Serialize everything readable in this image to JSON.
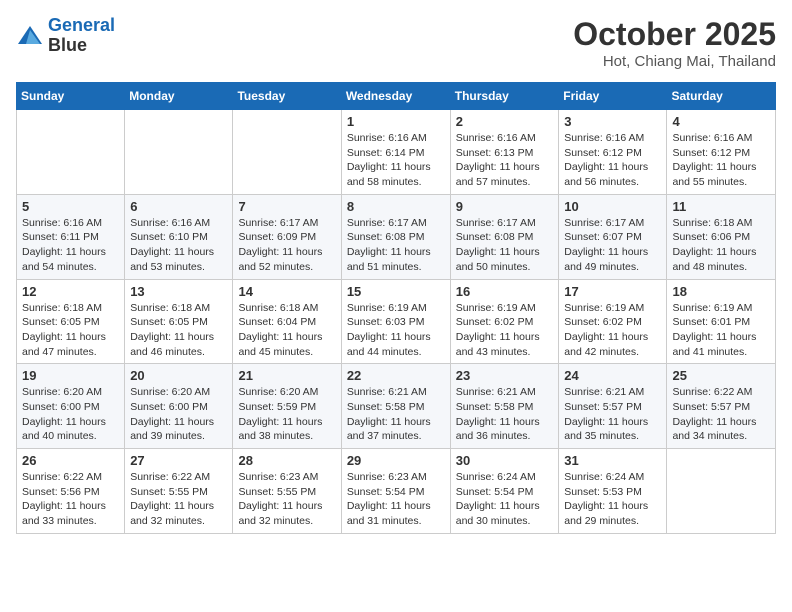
{
  "header": {
    "logo_line1": "General",
    "logo_line2": "Blue",
    "month": "October 2025",
    "location": "Hot, Chiang Mai, Thailand"
  },
  "weekdays": [
    "Sunday",
    "Monday",
    "Tuesday",
    "Wednesday",
    "Thursday",
    "Friday",
    "Saturday"
  ],
  "weeks": [
    [
      {
        "day": "",
        "info": ""
      },
      {
        "day": "",
        "info": ""
      },
      {
        "day": "",
        "info": ""
      },
      {
        "day": "1",
        "info": "Sunrise: 6:16 AM\nSunset: 6:14 PM\nDaylight: 11 hours\nand 58 minutes."
      },
      {
        "day": "2",
        "info": "Sunrise: 6:16 AM\nSunset: 6:13 PM\nDaylight: 11 hours\nand 57 minutes."
      },
      {
        "day": "3",
        "info": "Sunrise: 6:16 AM\nSunset: 6:12 PM\nDaylight: 11 hours\nand 56 minutes."
      },
      {
        "day": "4",
        "info": "Sunrise: 6:16 AM\nSunset: 6:12 PM\nDaylight: 11 hours\nand 55 minutes."
      }
    ],
    [
      {
        "day": "5",
        "info": "Sunrise: 6:16 AM\nSunset: 6:11 PM\nDaylight: 11 hours\nand 54 minutes."
      },
      {
        "day": "6",
        "info": "Sunrise: 6:16 AM\nSunset: 6:10 PM\nDaylight: 11 hours\nand 53 minutes."
      },
      {
        "day": "7",
        "info": "Sunrise: 6:17 AM\nSunset: 6:09 PM\nDaylight: 11 hours\nand 52 minutes."
      },
      {
        "day": "8",
        "info": "Sunrise: 6:17 AM\nSunset: 6:08 PM\nDaylight: 11 hours\nand 51 minutes."
      },
      {
        "day": "9",
        "info": "Sunrise: 6:17 AM\nSunset: 6:08 PM\nDaylight: 11 hours\nand 50 minutes."
      },
      {
        "day": "10",
        "info": "Sunrise: 6:17 AM\nSunset: 6:07 PM\nDaylight: 11 hours\nand 49 minutes."
      },
      {
        "day": "11",
        "info": "Sunrise: 6:18 AM\nSunset: 6:06 PM\nDaylight: 11 hours\nand 48 minutes."
      }
    ],
    [
      {
        "day": "12",
        "info": "Sunrise: 6:18 AM\nSunset: 6:05 PM\nDaylight: 11 hours\nand 47 minutes."
      },
      {
        "day": "13",
        "info": "Sunrise: 6:18 AM\nSunset: 6:05 PM\nDaylight: 11 hours\nand 46 minutes."
      },
      {
        "day": "14",
        "info": "Sunrise: 6:18 AM\nSunset: 6:04 PM\nDaylight: 11 hours\nand 45 minutes."
      },
      {
        "day": "15",
        "info": "Sunrise: 6:19 AM\nSunset: 6:03 PM\nDaylight: 11 hours\nand 44 minutes."
      },
      {
        "day": "16",
        "info": "Sunrise: 6:19 AM\nSunset: 6:02 PM\nDaylight: 11 hours\nand 43 minutes."
      },
      {
        "day": "17",
        "info": "Sunrise: 6:19 AM\nSunset: 6:02 PM\nDaylight: 11 hours\nand 42 minutes."
      },
      {
        "day": "18",
        "info": "Sunrise: 6:19 AM\nSunset: 6:01 PM\nDaylight: 11 hours\nand 41 minutes."
      }
    ],
    [
      {
        "day": "19",
        "info": "Sunrise: 6:20 AM\nSunset: 6:00 PM\nDaylight: 11 hours\nand 40 minutes."
      },
      {
        "day": "20",
        "info": "Sunrise: 6:20 AM\nSunset: 6:00 PM\nDaylight: 11 hours\nand 39 minutes."
      },
      {
        "day": "21",
        "info": "Sunrise: 6:20 AM\nSunset: 5:59 PM\nDaylight: 11 hours\nand 38 minutes."
      },
      {
        "day": "22",
        "info": "Sunrise: 6:21 AM\nSunset: 5:58 PM\nDaylight: 11 hours\nand 37 minutes."
      },
      {
        "day": "23",
        "info": "Sunrise: 6:21 AM\nSunset: 5:58 PM\nDaylight: 11 hours\nand 36 minutes."
      },
      {
        "day": "24",
        "info": "Sunrise: 6:21 AM\nSunset: 5:57 PM\nDaylight: 11 hours\nand 35 minutes."
      },
      {
        "day": "25",
        "info": "Sunrise: 6:22 AM\nSunset: 5:57 PM\nDaylight: 11 hours\nand 34 minutes."
      }
    ],
    [
      {
        "day": "26",
        "info": "Sunrise: 6:22 AM\nSunset: 5:56 PM\nDaylight: 11 hours\nand 33 minutes."
      },
      {
        "day": "27",
        "info": "Sunrise: 6:22 AM\nSunset: 5:55 PM\nDaylight: 11 hours\nand 32 minutes."
      },
      {
        "day": "28",
        "info": "Sunrise: 6:23 AM\nSunset: 5:55 PM\nDaylight: 11 hours\nand 32 minutes."
      },
      {
        "day": "29",
        "info": "Sunrise: 6:23 AM\nSunset: 5:54 PM\nDaylight: 11 hours\nand 31 minutes."
      },
      {
        "day": "30",
        "info": "Sunrise: 6:24 AM\nSunset: 5:54 PM\nDaylight: 11 hours\nand 30 minutes."
      },
      {
        "day": "31",
        "info": "Sunrise: 6:24 AM\nSunset: 5:53 PM\nDaylight: 11 hours\nand 29 minutes."
      },
      {
        "day": "",
        "info": ""
      }
    ]
  ]
}
